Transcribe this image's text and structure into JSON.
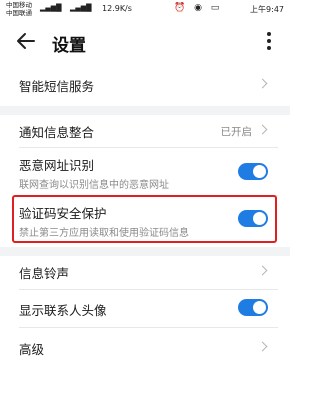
{
  "status_bar": {
    "carrier1": "中国移动",
    "carrier2": "中国联通",
    "speed": "12.9K/s",
    "time_label": "上午9:47"
  },
  "header": {
    "title": "设置"
  },
  "items": {
    "smart_sms": {
      "label": "智能短信服务"
    },
    "notification": {
      "label": "通知信息整合",
      "value": "已开启"
    },
    "malicious_url": {
      "label": "恶意网址识别",
      "sub": "联网查询以识别信息中的恶意网址",
      "enabled": true
    },
    "code_protect": {
      "label": "验证码安全保护",
      "sub": "禁止第三方应用读取和使用验证码信息",
      "enabled": true
    },
    "ringtone": {
      "label": "信息铃声"
    },
    "avatar": {
      "label": "显示联系人头像",
      "enabled": true
    },
    "advanced": {
      "label": "高级"
    }
  },
  "colors": {
    "accent": "#1f7ce3",
    "highlight": "#e02020"
  }
}
